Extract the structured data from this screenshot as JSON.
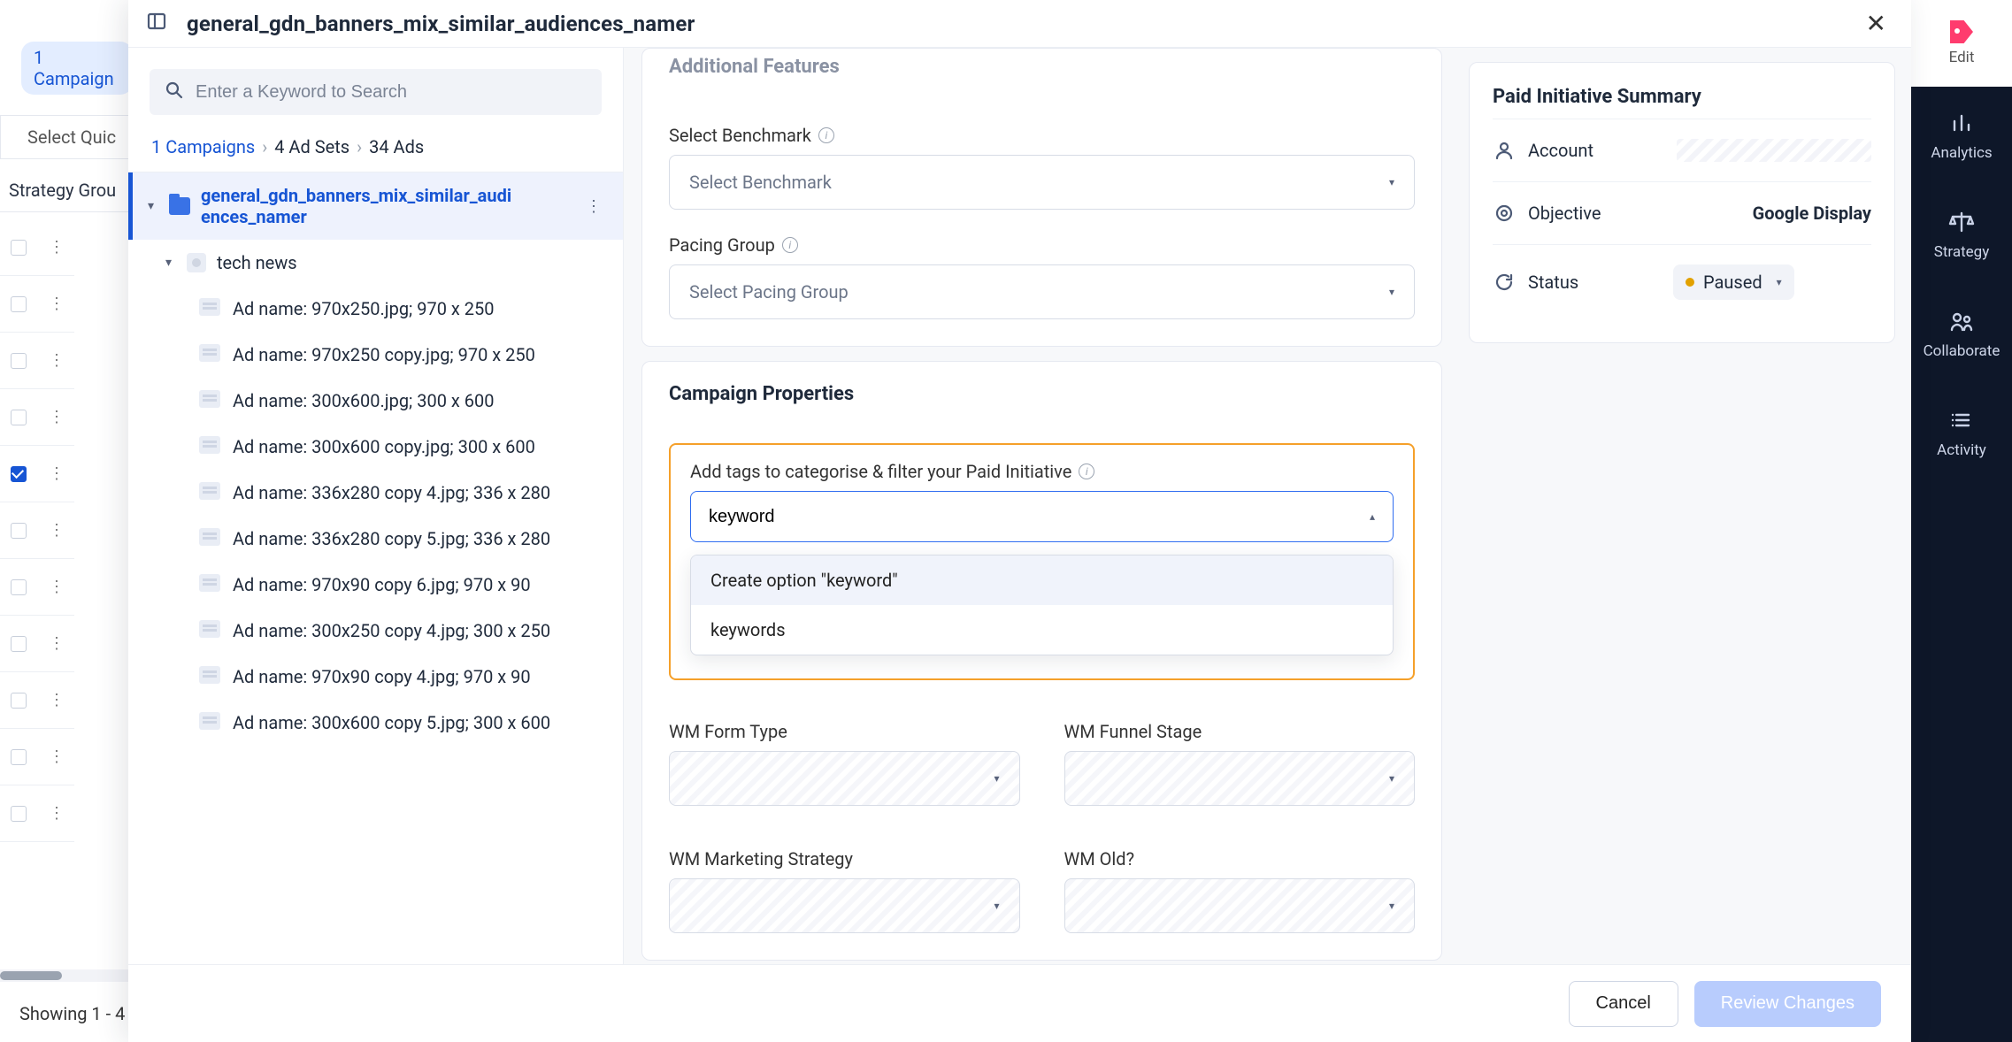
{
  "bg": {
    "pill": "1 Campaign",
    "select_quick": "Select Quic",
    "strategy_col": "Strategy Grou",
    "footer": "Showing 1 - 4"
  },
  "header": {
    "title": "general_gdn_banners_mix_similar_audiences_namer"
  },
  "search": {
    "placeholder": "Enter a Keyword to Search"
  },
  "breadcrumb": {
    "campaigns": "1 Campaigns",
    "adsets": "4 Ad Sets",
    "ads": "34 Ads"
  },
  "tree": {
    "root": "general_gdn_banners_mix_similar_audiences_namer",
    "group": "tech news",
    "ads": [
      "Ad name: 970x250.jpg; 970 x 250",
      "Ad name: 970x250 copy.jpg; 970 x 250",
      "Ad name: 300x600.jpg; 300 x 600",
      "Ad name: 300x600 copy.jpg; 300 x 600",
      "Ad name: 336x280 copy 4.jpg; 336 x 280",
      "Ad name: 336x280 copy 5.jpg; 336 x 280",
      "Ad name: 970x90 copy 6.jpg; 970 x 90",
      "Ad name: 300x250 copy 4.jpg; 300 x 250",
      "Ad name: 970x90 copy 4.jpg; 970 x 90",
      "Ad name: 300x600 copy 5.jpg; 300 x 600"
    ]
  },
  "features": {
    "heading_cut": "Additional Features",
    "benchmark_label": "Select Benchmark",
    "benchmark_placeholder": "Select Benchmark",
    "pacing_label": "Pacing Group",
    "pacing_placeholder": "Select Pacing Group"
  },
  "properties": {
    "heading": "Campaign Properties",
    "tags_label": "Add tags to categorise & filter your Paid Initiative",
    "tags_value": "keyword",
    "dropdown_create": "Create option \"keyword\"",
    "dropdown_existing": "keywords",
    "fields": {
      "form_type": "WM Form Type",
      "funnel_stage": "WM Funnel Stage",
      "marketing_strategy": "WM Marketing Strategy",
      "old": "WM Old?"
    }
  },
  "summary": {
    "heading": "Paid Initiative Summary",
    "account_label": "Account",
    "objective_label": "Objective",
    "objective_value": "Google Display",
    "status_label": "Status",
    "status_value": "Paused"
  },
  "footer": {
    "cancel": "Cancel",
    "review": "Review Changes"
  },
  "rail": {
    "edit": "Edit",
    "analytics": "Analytics",
    "strategy": "Strategy",
    "collaborate": "Collaborate",
    "activity": "Activity"
  }
}
